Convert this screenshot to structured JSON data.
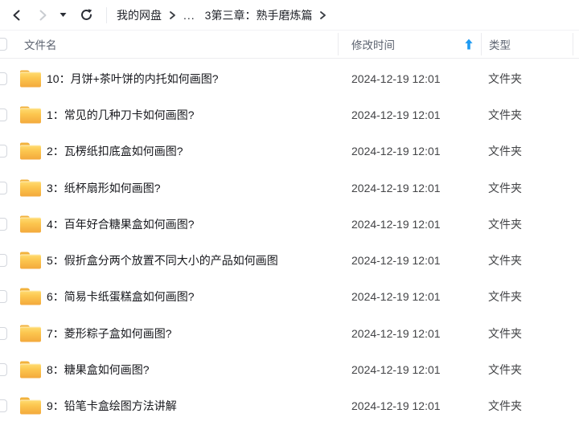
{
  "navbar": {
    "back_tooltip": "back",
    "forward_tooltip": "forward",
    "breadcrumb": {
      "root": "我的网盘",
      "collapsed": "...",
      "current": "3第三章：熟手磨炼篇"
    }
  },
  "table": {
    "headers": {
      "name": "文件名",
      "modified": "修改时间",
      "type": "类型"
    },
    "sort": {
      "column": "修改时间",
      "direction": "ascending",
      "arrow_color": "#1d9af2"
    },
    "rows": [
      {
        "name": "10：月饼+茶叶饼的内托如何画图?",
        "modified": "2024-12-19 12:01",
        "type": "文件夹",
        "icon": "folder-icon"
      },
      {
        "name": "1：常见的几种刀卡如何画图?",
        "modified": "2024-12-19 12:01",
        "type": "文件夹",
        "icon": "folder-icon"
      },
      {
        "name": "2：瓦楞纸扣底盒如何画图?",
        "modified": "2024-12-19 12:01",
        "type": "文件夹",
        "icon": "folder-icon"
      },
      {
        "name": "3：纸杯扇形如何画图?",
        "modified": "2024-12-19 12:01",
        "type": "文件夹",
        "icon": "folder-icon"
      },
      {
        "name": "4：百年好合糖果盒如何画图?",
        "modified": "2024-12-19 12:01",
        "type": "文件夹",
        "icon": "folder-icon"
      },
      {
        "name": "5：假折盒分两个放置不同大小的产品如何画图",
        "modified": "2024-12-19 12:01",
        "type": "文件夹",
        "icon": "folder-icon"
      },
      {
        "name": "6：简易卡纸蛋糕盒如何画图?",
        "modified": "2024-12-19 12:01",
        "type": "文件夹",
        "icon": "folder-icon"
      },
      {
        "name": "7：菱形粽子盒如何画图?",
        "modified": "2024-12-19 12:01",
        "type": "文件夹",
        "icon": "folder-icon"
      },
      {
        "name": "8：糖果盒如何画图?",
        "modified": "2024-12-19 12:01",
        "type": "文件夹",
        "icon": "folder-icon"
      },
      {
        "name": "9：铅笔卡盒绘图方法讲解",
        "modified": "2024-12-19 12:01",
        "type": "文件夹",
        "icon": "folder-icon"
      }
    ]
  },
  "colors": {
    "accent_blue": "#1d9af2",
    "folder_yellow_top": "#ffdd74",
    "folder_yellow_bottom": "#f3a93c",
    "icon_dark": "#2b2e36",
    "icon_disabled": "#c9ccd1"
  }
}
